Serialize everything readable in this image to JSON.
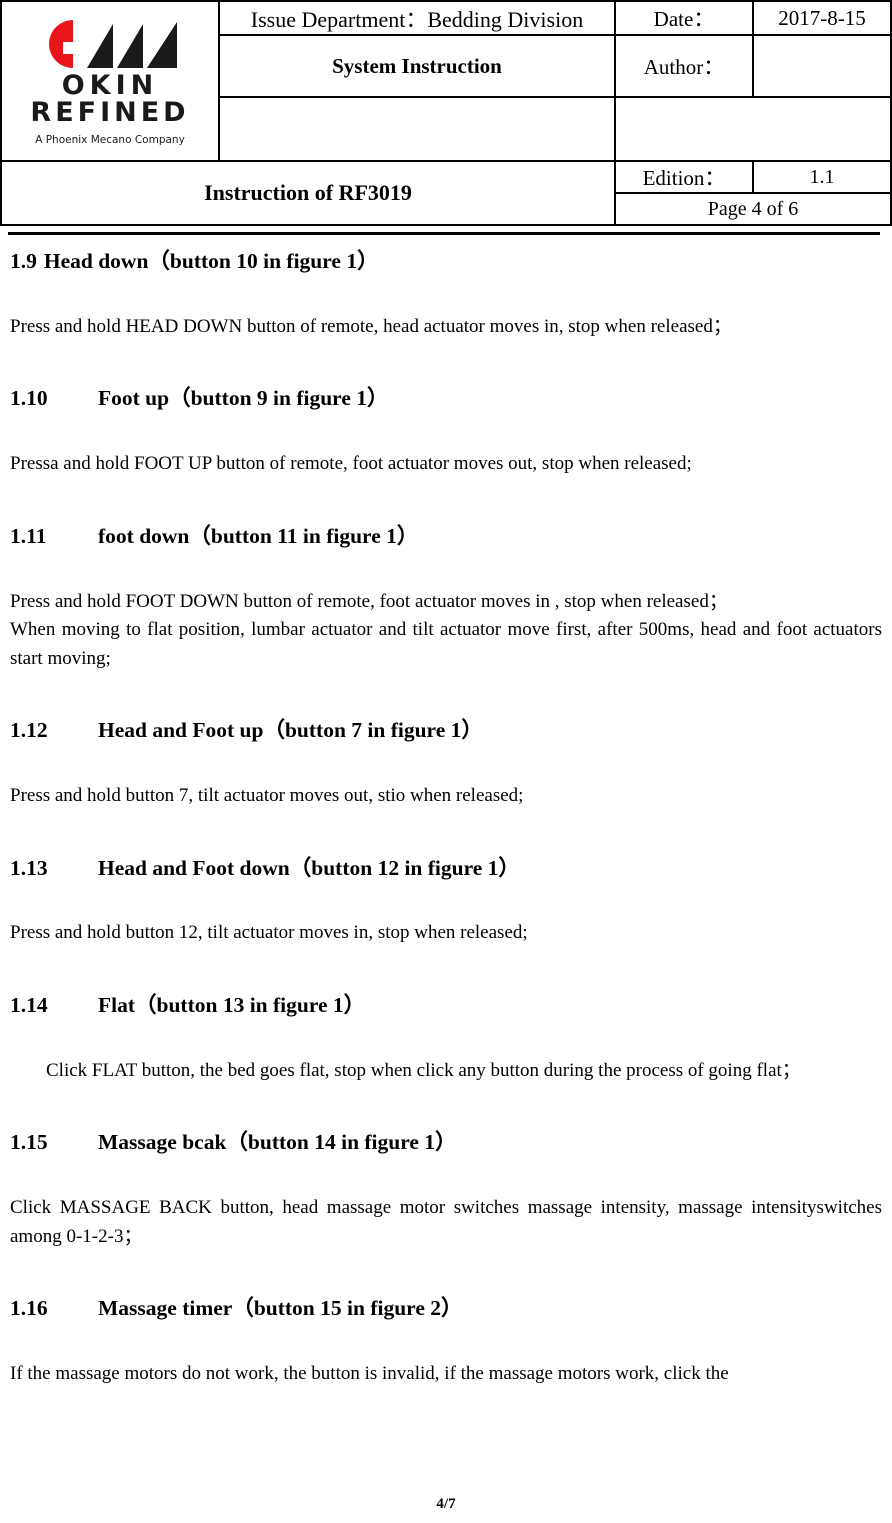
{
  "header": {
    "logo": {
      "brand_line1": "OKIN",
      "brand_line2": "REFINED",
      "tagline": "A Phoenix Mecano Company",
      "red_color": "#E8161A",
      "black_color": "#1A1A1A"
    },
    "issue_department": "Issue Department：Bedding Division",
    "doc_type": "System Instruction",
    "date_label": "Date：",
    "date_value": "2017-8-15",
    "author_label": "Author：",
    "author_value": "",
    "blank_mid_left": "",
    "blank_mid_right": "",
    "instruction_title": "Instruction of RF3019",
    "edition_label": "Edition：",
    "edition_value": "1.1",
    "page_indicator": "Page 4 of 6"
  },
  "sections": [
    {
      "number": "1.9",
      "number_narrow": true,
      "title": "Head down（button 10 in figure 1）",
      "paragraphs": [
        {
          "text": "Press and hold HEAD DOWN button of remote, head actuator moves in, stop when released；",
          "indent": false
        }
      ]
    },
    {
      "number": "1.10",
      "number_narrow": false,
      "title": "Foot up（button 9 in figure 1）",
      "paragraphs": [
        {
          "text": "Pressa and hold FOOT UP button of remote, foot actuator moves out, stop when released;",
          "indent": false
        }
      ]
    },
    {
      "number": "1.11",
      "number_narrow": false,
      "title": "foot down（button 11 in figure 1）",
      "paragraphs": [
        {
          "text": "Press and hold FOOT DOWN button of remote, foot actuator moves in , stop when released；",
          "indent": false
        },
        {
          "text": "When moving to flat position, lumbar actuator and tilt actuator move first, after 500ms, head and foot actuators start moving;",
          "indent": false
        }
      ]
    },
    {
      "number": "1.12",
      "number_narrow": false,
      "title": "Head and Foot up（button 7 in figure 1）",
      "paragraphs": [
        {
          "text": "Press and hold button 7, tilt actuator moves out, stio when released;",
          "indent": false
        }
      ]
    },
    {
      "number": "1.13",
      "number_narrow": false,
      "title": "Head and Foot down（button 12 in figure 1）",
      "paragraphs": [
        {
          "text": "Press and hold button 12, tilt actuator moves in, stop when released;",
          "indent": false
        }
      ]
    },
    {
      "number": "1.14",
      "number_narrow": false,
      "title": "Flat（button 13 in figure 1）",
      "paragraphs": [
        {
          "text": "Click FLAT button, the bed goes flat, stop when click any button during the process of going flat；",
          "indent": true
        }
      ]
    },
    {
      "number": "1.15",
      "number_narrow": false,
      "title": "Massage bcak（button 14 in figure 1）",
      "paragraphs": [
        {
          "text": "Click MASSAGE BACK button, head massage motor switches massage intensity, massage intensityswitches among 0-1-2-3；",
          "indent": false
        }
      ]
    },
    {
      "number": "1.16",
      "number_narrow": false,
      "title": "Massage timer（button 15 in figure 2）",
      "paragraphs": [
        {
          "text": "If the massage motors do not work, the button is invalid, if the massage motors work, click the",
          "indent": false
        }
      ]
    }
  ],
  "footer": {
    "page_number": "4/7"
  }
}
